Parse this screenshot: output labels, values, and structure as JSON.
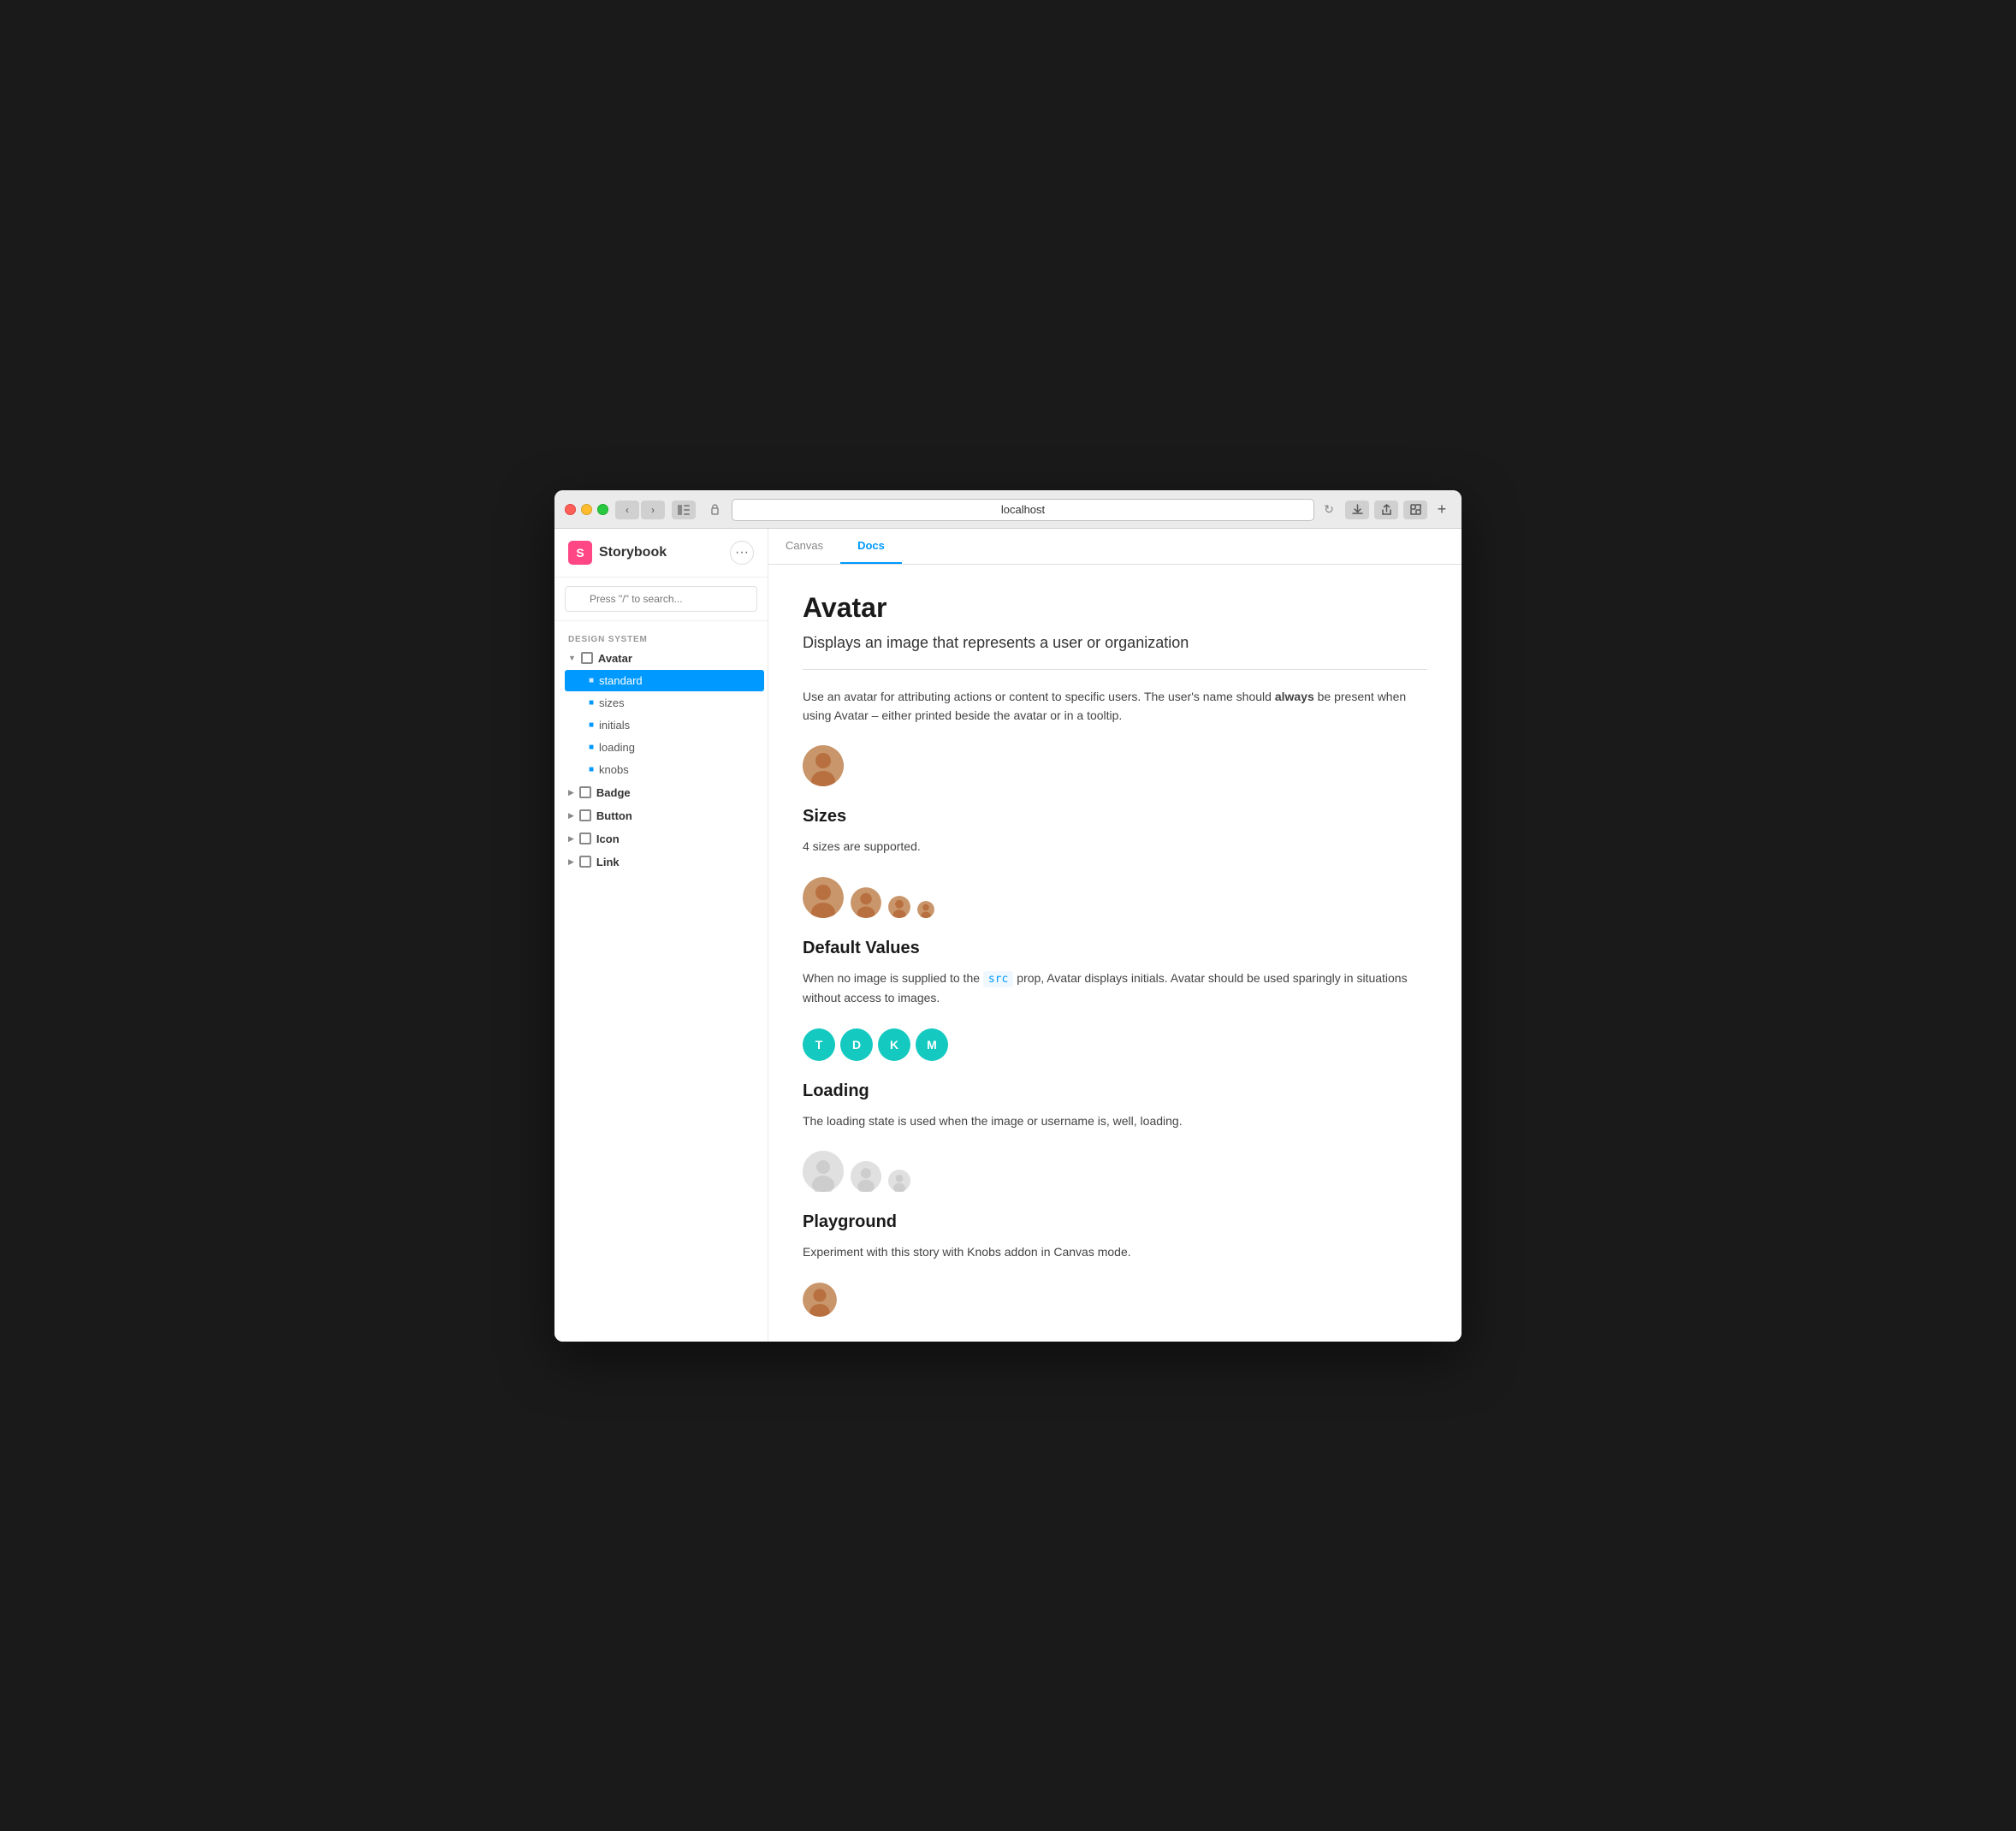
{
  "browser": {
    "url": "localhost",
    "tab_plus": "+"
  },
  "storybook": {
    "logo_letter": "S",
    "title": "Storybook",
    "search_placeholder": "Press \"/\" to search...",
    "menu_dots": "···"
  },
  "sidebar": {
    "section_label": "DESIGN SYSTEM",
    "groups": [
      {
        "name": "Avatar",
        "expanded": true,
        "items": [
          {
            "label": "standard",
            "active": true
          },
          {
            "label": "sizes",
            "active": false
          },
          {
            "label": "initials",
            "active": false
          },
          {
            "label": "loading",
            "active": false
          },
          {
            "label": "knobs",
            "active": false
          }
        ]
      },
      {
        "name": "Badge",
        "expanded": false,
        "items": []
      },
      {
        "name": "Button",
        "expanded": false,
        "items": []
      },
      {
        "name": "Icon",
        "expanded": false,
        "items": []
      },
      {
        "name": "Link",
        "expanded": false,
        "items": []
      }
    ]
  },
  "tabs": [
    {
      "label": "Canvas",
      "active": false
    },
    {
      "label": "Docs",
      "active": true
    }
  ],
  "docs": {
    "title": "Avatar",
    "subtitle": "Displays an image that represents a user or organization",
    "intro": "Use an avatar for attributing actions or content to specific users. The user's name should ",
    "intro_bold": "always",
    "intro_end": " be present when using Avatar – either printed beside the avatar or in a tooltip.",
    "sizes_title": "Sizes",
    "sizes_desc": "4 sizes are supported.",
    "default_values_title": "Default Values",
    "default_values_desc_pre": "When no image is supplied to the ",
    "default_values_code": "src",
    "default_values_desc_post": " prop, Avatar displays initials. Avatar should be used sparingly in situations without access to images.",
    "loading_title": "Loading",
    "loading_desc": "The loading state is used when the image or username is, well, loading.",
    "playground_title": "Playground",
    "playground_desc": "Experiment with this story with Knobs addon in Canvas mode.",
    "initials": [
      "T",
      "D",
      "K",
      "M"
    ]
  }
}
